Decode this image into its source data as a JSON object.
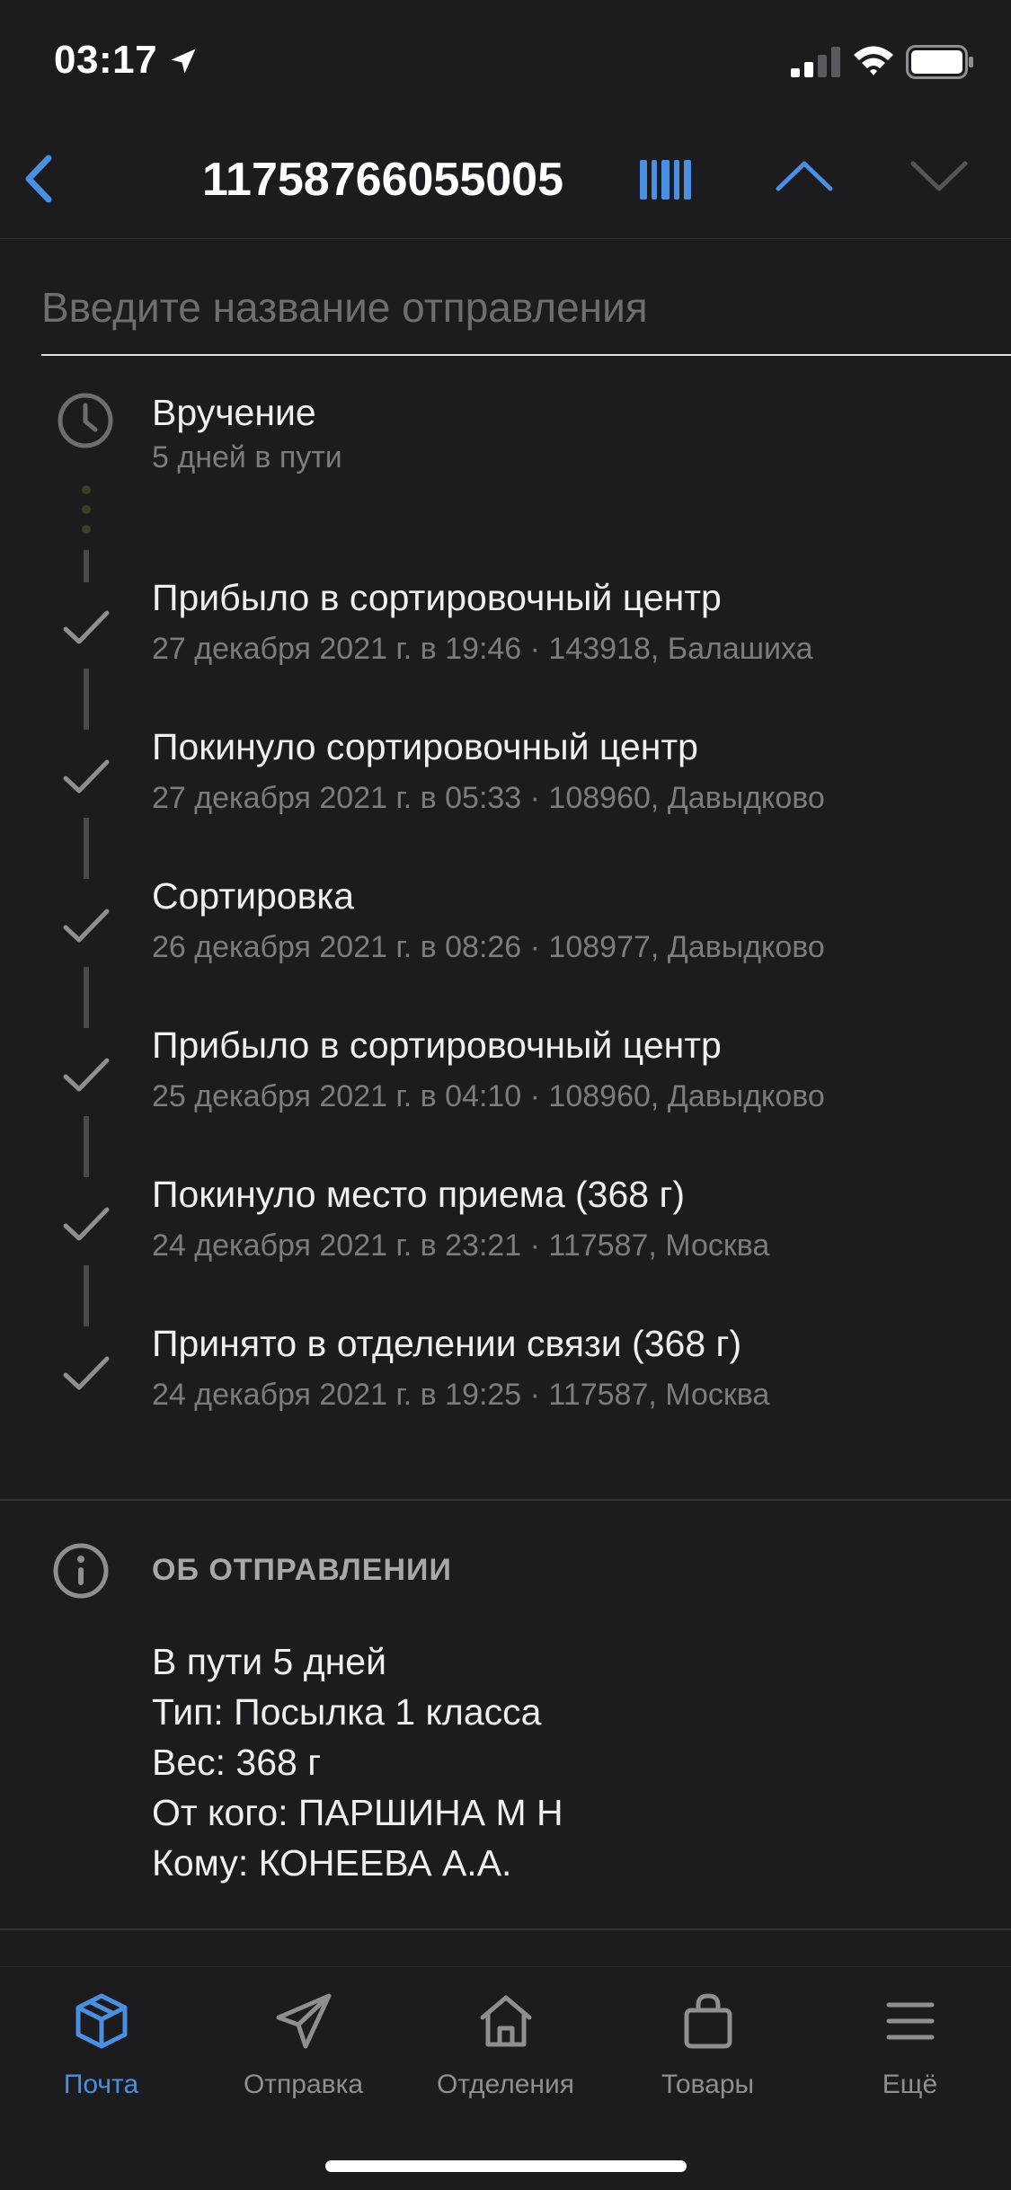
{
  "status_bar": {
    "time": "03:17"
  },
  "header": {
    "title": "11758766055005"
  },
  "name_input": {
    "placeholder": "Введите название отправления",
    "value": ""
  },
  "next_step": {
    "title": "Вручение",
    "subtitle": "5 дней в пути"
  },
  "events": [
    {
      "title": "Прибыло в сортировочный центр",
      "subtitle": "27 декабря 2021 г. в 19:46 · 143918, Балашиха"
    },
    {
      "title": "Покинуло сортировочный центр",
      "subtitle": "27 декабря 2021 г. в 05:33 · 108960, Давыдково"
    },
    {
      "title": "Сортировка",
      "subtitle": "26 декабря 2021 г. в 08:26 · 108977, Давыдково"
    },
    {
      "title": "Прибыло в сортировочный центр",
      "subtitle": "25 декабря 2021 г. в 04:10 · 108960, Давыдково"
    },
    {
      "title": "Покинуло место приема  (368 г)",
      "subtitle": "24 декабря 2021 г. в 23:21 · 117587, Москва"
    },
    {
      "title": "Принято в отделении связи  (368 г)",
      "subtitle": "24 декабря 2021 г. в 19:25 · 117587, Москва"
    }
  ],
  "about": {
    "heading": "ОБ ОТПРАВЛЕНИИ",
    "lines": [
      "В пути 5 дней",
      "Тип: Посылка 1 класса",
      "Вес: 368 г",
      "От кого: ПАРШИНА М Н",
      "Кому: КОНЕЕВА А.А."
    ]
  },
  "tabs": [
    {
      "label": "Почта",
      "icon": "box-icon",
      "active": true
    },
    {
      "label": "Отправка",
      "icon": "paper-plane-icon",
      "active": false
    },
    {
      "label": "Отделения",
      "icon": "post-office-icon",
      "active": false
    },
    {
      "label": "Товары",
      "icon": "shopping-bag-icon",
      "active": false
    },
    {
      "label": "Ещё",
      "icon": "menu-icon",
      "active": false
    }
  ],
  "colors": {
    "accent": "#4a90e2",
    "background": "#1c1c1e",
    "muted_text": "#7c7c80"
  }
}
